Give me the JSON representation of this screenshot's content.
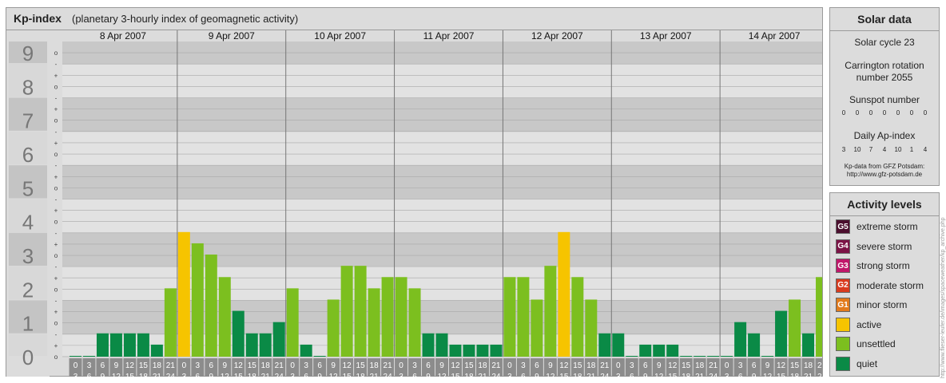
{
  "header": {
    "title": "Kp-index",
    "subtitle": "(planetary 3-hourly index of geomagnetic activity)"
  },
  "chart_data": {
    "type": "bar",
    "title": "Kp-index",
    "subtitle": "(planetary 3-hourly index of geomagnetic activity)",
    "ylim": [
      0,
      9
    ],
    "y_ticks": [
      "0",
      "1",
      "2",
      "3",
      "4",
      "5",
      "6",
      "7",
      "8",
      "9"
    ],
    "minor_marks": [
      "o",
      "+",
      "-"
    ],
    "days": [
      "8 Apr 2007",
      "9 Apr 2007",
      "10 Apr 2007",
      "11 Apr 2007",
      "12 Apr 2007",
      "13 Apr 2007",
      "14 Apr 2007"
    ],
    "interval_starts": [
      "0",
      "3",
      "6",
      "9",
      "12",
      "15",
      "18",
      "21"
    ],
    "interval_ends": [
      "3",
      "6",
      "9",
      "12",
      "15",
      "18",
      "21",
      "24"
    ],
    "values": [
      0,
      0,
      0.667,
      0.667,
      0.667,
      0.667,
      0.333,
      2,
      3.667,
      3.333,
      3,
      2.333,
      1.333,
      0.667,
      0.667,
      1,
      2,
      0.333,
      0,
      1.667,
      2.667,
      2.667,
      2,
      2.333,
      2.333,
      2,
      0.667,
      0.667,
      0.333,
      0.333,
      0.333,
      0.333,
      2.333,
      2.333,
      1.667,
      2.667,
      3.667,
      2.333,
      1.667,
      0.667,
      0.667,
      0,
      0.333,
      0.333,
      0.333,
      0,
      0,
      0,
      0,
      1,
      0.667,
      0,
      1.333,
      1.667,
      0.667,
      2.333
    ],
    "levels": [
      {
        "name": "quiet",
        "color": "#0a8a46"
      },
      {
        "name": "unsettled",
        "color": "#7cbf1f"
      },
      {
        "name": "active",
        "color": "#f6c400"
      }
    ],
    "grid": true
  },
  "solar": {
    "title": "Solar data",
    "cycle": "Solar cycle 23",
    "carrington_line1": "Carrington rotation",
    "carrington_line2": "number 2055",
    "sunspot_label": "Sunspot number",
    "sunspot": [
      "0",
      "0",
      "0",
      "0",
      "0",
      "0",
      "0"
    ],
    "ap_label": "Daily Ap-index",
    "ap": [
      "3",
      "10",
      "7",
      "4",
      "10",
      "1",
      "4"
    ],
    "source_line1": "Kp-data from GFZ Potsdam:",
    "source_line2": "http://www.gfz-potsdam.de"
  },
  "activity": {
    "title": "Activity levels",
    "items": [
      {
        "code": "G5",
        "label": "extreme storm",
        "color": "#4b0f2e"
      },
      {
        "code": "G4",
        "label": "severe storm",
        "color": "#7c1346"
      },
      {
        "code": "G3",
        "label": "strong storm",
        "color": "#c0176a"
      },
      {
        "code": "G2",
        "label": "moderate storm",
        "color": "#d93b1f"
      },
      {
        "code": "G1",
        "label": "minor storm",
        "color": "#e27a1c"
      },
      {
        "code": "",
        "label": "active",
        "color": "#f6c400"
      },
      {
        "code": "",
        "label": "unsettled",
        "color": "#7cbf1f"
      },
      {
        "code": "",
        "label": "quiet",
        "color": "#0a8a46"
      }
    ]
  },
  "credit": "http://www.flieser-leufer.de/images/spaceweather/kp_archive.php"
}
